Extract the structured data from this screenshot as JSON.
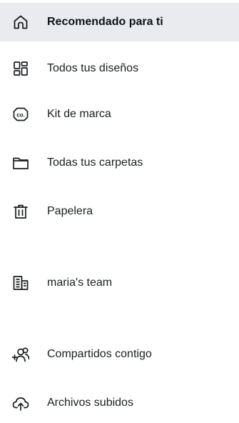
{
  "nav": {
    "items": [
      {
        "id": "recommended",
        "label": "Recomendado para ti",
        "icon": "home-icon",
        "active": true
      },
      {
        "id": "designs",
        "label": "Todos tus diseños",
        "icon": "grid-icon"
      },
      {
        "id": "brand-kit",
        "label": "Kit de marca",
        "icon": "brand-kit-icon",
        "icon_text": "co."
      },
      {
        "id": "folders",
        "label": "Todas tus carpetas",
        "icon": "folder-icon"
      },
      {
        "id": "trash",
        "label": "Papelera",
        "icon": "trash-icon"
      },
      {
        "id": "team",
        "label": "maria's team",
        "icon": "team-building-icon"
      },
      {
        "id": "shared",
        "label": "Compartidos contigo",
        "icon": "add-people-icon"
      },
      {
        "id": "uploads",
        "label": "Archivos subidos",
        "icon": "cloud-upload-icon"
      }
    ]
  },
  "colors": {
    "active_bg": "#e9ebee",
    "text": "#1a1d21"
  }
}
